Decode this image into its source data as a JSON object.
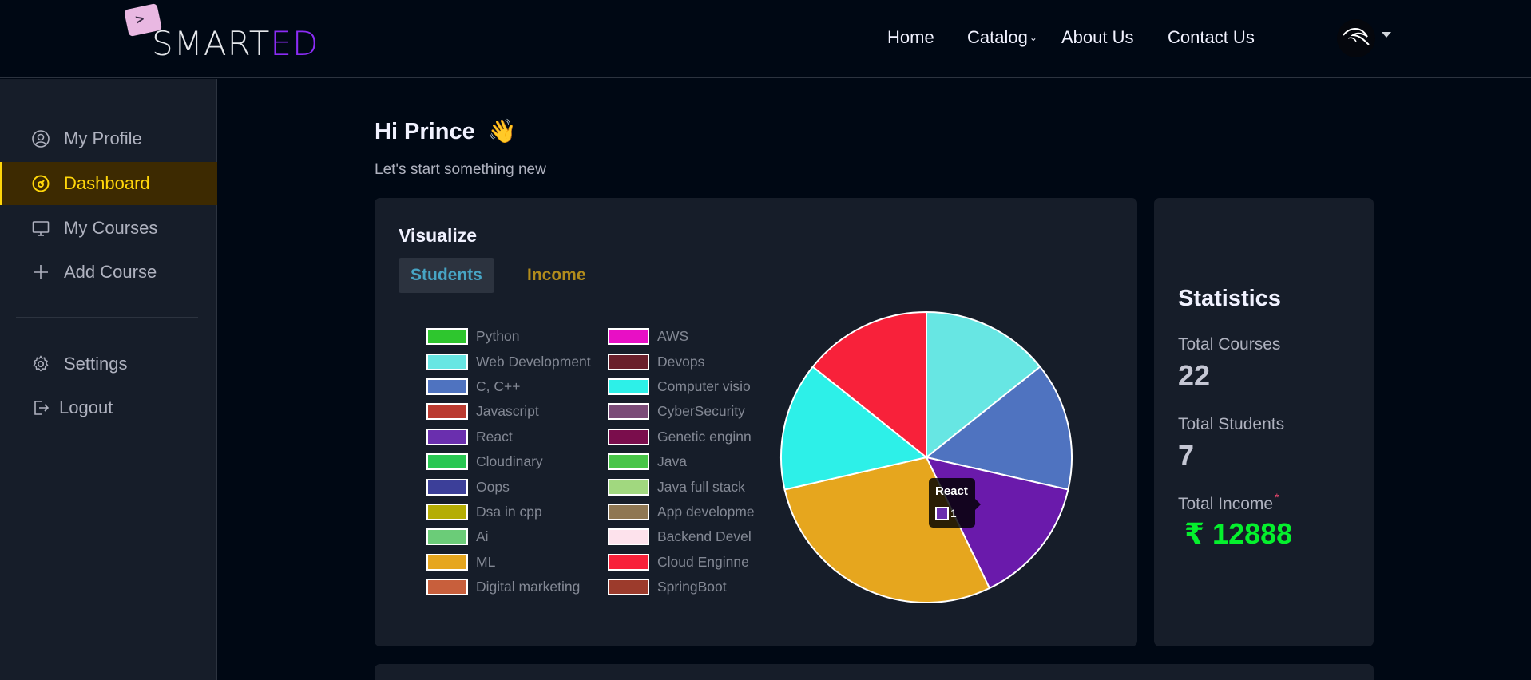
{
  "brand": {
    "logo_part1": "SMART",
    "logo_part2": "ED"
  },
  "nav": {
    "home": "Home",
    "catalog": "Catalog",
    "about": "About Us",
    "contact": "Contact Us"
  },
  "sidebar": {
    "items": [
      {
        "label": "My Profile",
        "icon": "user-circle-icon"
      },
      {
        "label": "Dashboard",
        "icon": "dashboard-gauge-icon"
      },
      {
        "label": "My Courses",
        "icon": "monitor-icon"
      },
      {
        "label": "Add Course",
        "icon": "plus-icon"
      }
    ],
    "settings": "Settings",
    "logout": "Logout"
  },
  "greeting": {
    "title": "Hi Prince",
    "emoji": "👋",
    "subtitle": "Let's start something new"
  },
  "visualize": {
    "title": "Visualize",
    "tabs": {
      "students": "Students",
      "income": "Income"
    },
    "active_tab": "Students"
  },
  "chart_data": {
    "type": "pie",
    "categories": [
      "Python",
      "Web Development",
      "C, C++",
      "Javascript",
      "React",
      "Cloudinary",
      "Oops",
      "Dsa in cpp",
      "Ai",
      "ML",
      "Digital marketing",
      "AWS",
      "Devops",
      "Computer visio",
      "CyberSecurity",
      "Genetic enginn",
      "Java",
      "Java full stack",
      "App developme",
      "Backend Devel",
      "Cloud Enginne",
      "SpringBoot"
    ],
    "values": [
      0,
      1,
      1,
      0,
      1,
      0,
      0,
      0,
      0,
      2,
      0,
      0,
      0,
      1,
      0,
      0,
      0,
      0,
      0,
      0,
      1,
      0
    ],
    "colors": [
      "#2ec62e",
      "#67e6e3",
      "#4f73c0",
      "#bb3a30",
      "#6a2fae",
      "#28c752",
      "#3c3f99",
      "#b5ad04",
      "#6bcc78",
      "#e6a61e",
      "#c85f3c",
      "#e80fc5",
      "#6a1f2b",
      "#2df0e8",
      "#7b4b78",
      "#7a0d4c",
      "#48c548",
      "#a1d87f",
      "#8f7753",
      "#fde2ec",
      "#f8213a",
      "#9c3b2c"
    ],
    "slice_colors": [
      "#67e6e3",
      "#4f73c0",
      "#6a1aab",
      "#e6a61e",
      "#2df0e8",
      "#f8213a"
    ],
    "tooltip": {
      "title": "React",
      "value": "1"
    },
    "legend_position": "left"
  },
  "statistics": {
    "title": "Statistics",
    "courses_label": "Total Courses",
    "courses_value": "22",
    "students_label": "Total Students",
    "students_value": "7",
    "income_label": "Total Income",
    "income_required_mark": "*",
    "income_value": "₹ 12888"
  }
}
